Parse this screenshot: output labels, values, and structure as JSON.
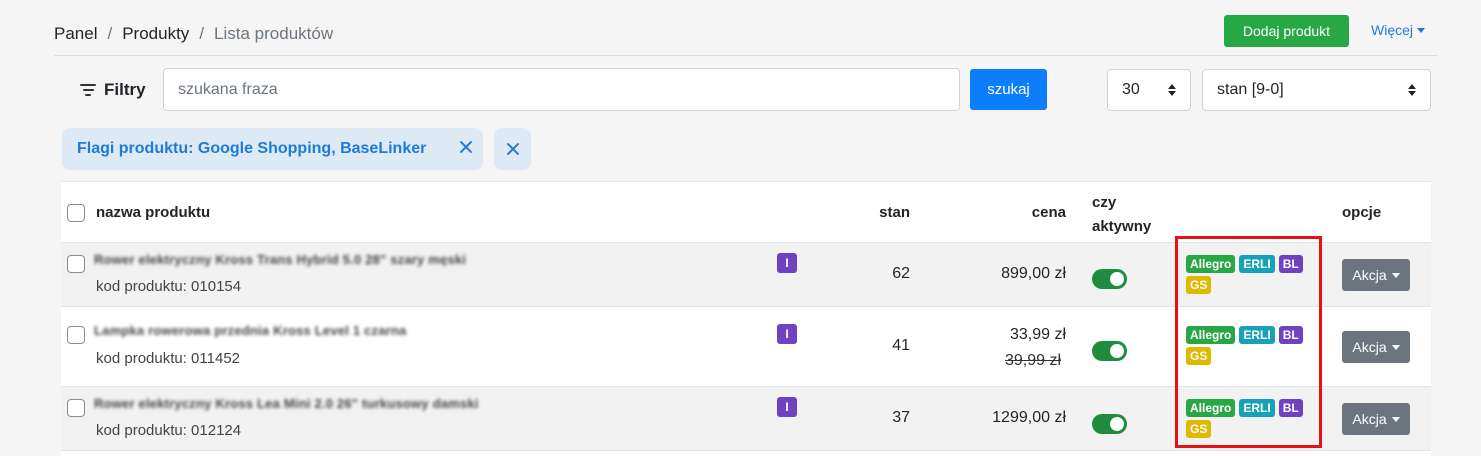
{
  "breadcrumb": {
    "items": [
      "Panel",
      "Produkty",
      "Lista produktów"
    ],
    "separator": "/"
  },
  "header": {
    "add_product_label": "Dodaj produkt",
    "more_label": "Więcej"
  },
  "filters": {
    "label": "Filtry",
    "search_placeholder": "szukana fraza",
    "search_value": "",
    "search_button": "szukaj",
    "per_page": "30",
    "sort": "stan [9-0]",
    "active_chip": "Flagi produktu: Google Shopping, BaseLinker"
  },
  "table": {
    "columns": {
      "name": "nazwa produktu",
      "stock": "stan",
      "price": "cena",
      "active_line1": "czy",
      "active_line2": "aktywny",
      "options": "opcje"
    },
    "code_prefix": "kod produktu: ",
    "rows": [
      {
        "name": "Rower elektryczny Kross Trans Hybrid 5.0 28\" szary męski",
        "code_label": "kod produktu: 010154",
        "badge": "I",
        "stock": "62",
        "price": "899,00 zł",
        "price_old": "",
        "active": true,
        "tags": [
          "Allegro",
          "ERLI",
          "BL",
          "GS"
        ],
        "action": "Akcja"
      },
      {
        "name": "Lampka rowerowa przednia Kross Level 1 czarna",
        "code_label": "kod produktu: 011452",
        "badge": "I",
        "stock": "41",
        "price": "33,99 zł",
        "price_old": "39,99 zł",
        "active": true,
        "tags": [
          "Allegro",
          "ERLI",
          "BL",
          "GS"
        ],
        "action": "Akcja"
      },
      {
        "name": "Rower elektryczny Kross Lea Mini 2.0 26\" turkusowy damski",
        "code_label": "kod produktu: 012124",
        "badge": "I",
        "stock": "37",
        "price": "1299,00 zł",
        "price_old": "",
        "active": true,
        "tags": [
          "Allegro",
          "ERLI",
          "BL",
          "GS"
        ],
        "action": "Akcja"
      }
    ]
  },
  "tag_colors": {
    "Allegro": "#28a745",
    "ERLI": "#17a2b8",
    "BL": "#6f42c1",
    "GS": "#e0b800"
  },
  "colors": {
    "primary": "#0d7efb",
    "success": "#28a745",
    "highlight": "#e31313"
  }
}
